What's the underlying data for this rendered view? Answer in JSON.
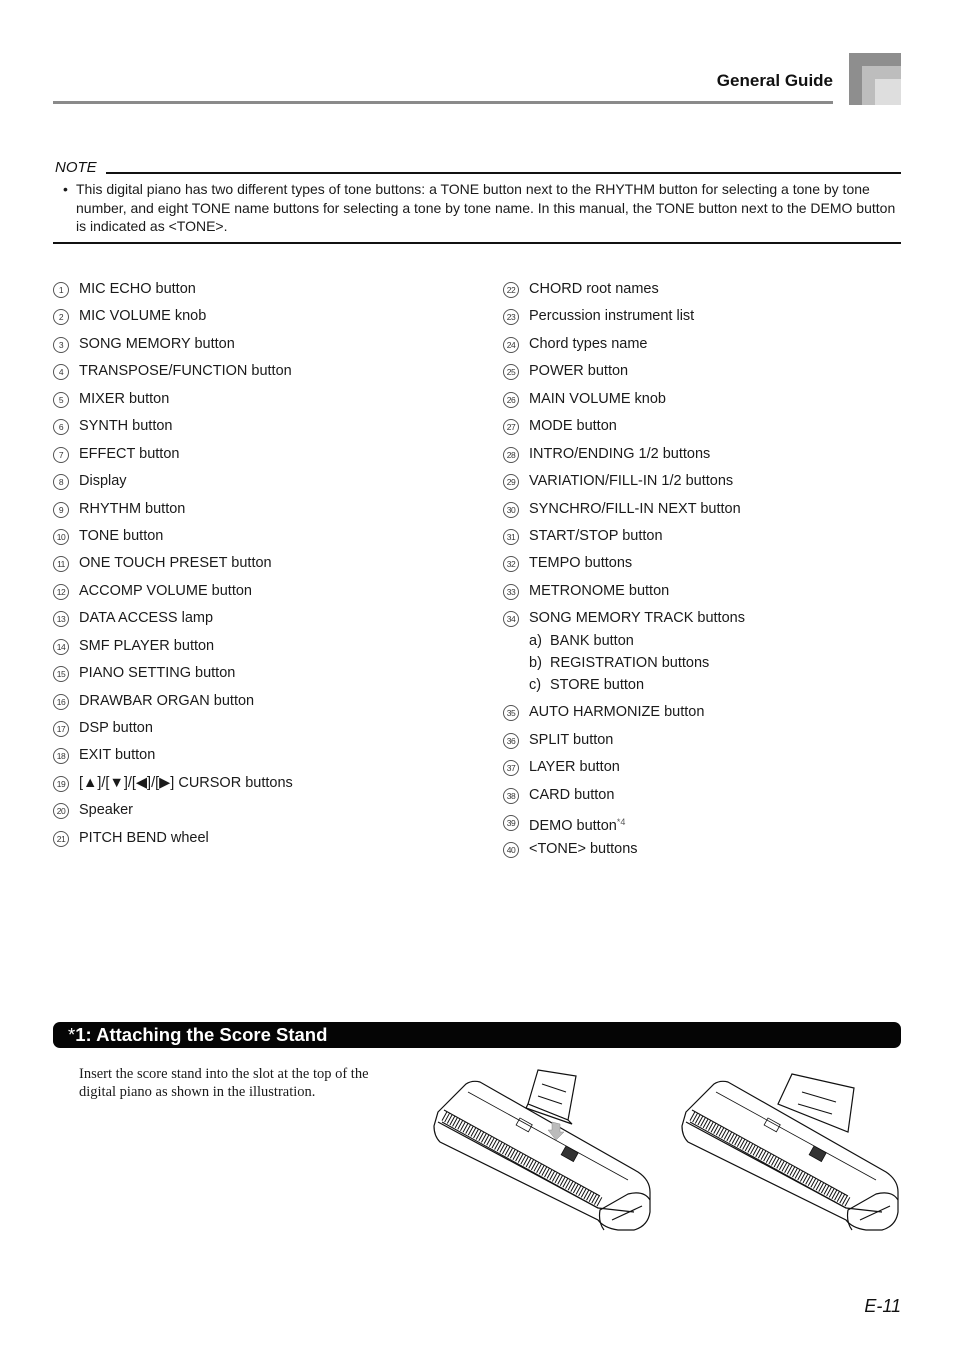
{
  "header": {
    "title": "General Guide"
  },
  "note": {
    "label": "NOTE",
    "bullet": "•",
    "text": "This digital piano has two different types of tone buttons: a TONE button next to the RHYTHM button for selecting a tone by tone number, and eight TONE name buttons for selecting a tone by tone name. In this manual, the TONE button next to the DEMO button is indicated as <TONE>."
  },
  "parts": {
    "left": [
      {
        "num": "1",
        "label": "MIC ECHO button"
      },
      {
        "num": "2",
        "label": "MIC VOLUME knob"
      },
      {
        "num": "3",
        "label": "SONG MEMORY button"
      },
      {
        "num": "4",
        "label": "TRANSPOSE/FUNCTION button"
      },
      {
        "num": "5",
        "label": "MIXER button"
      },
      {
        "num": "6",
        "label": "SYNTH button"
      },
      {
        "num": "7",
        "label": "EFFECT button"
      },
      {
        "num": "8",
        "label": "Display"
      },
      {
        "num": "9",
        "label": "RHYTHM button"
      },
      {
        "num": "10",
        "label": "TONE button"
      },
      {
        "num": "11",
        "label": "ONE TOUCH PRESET button"
      },
      {
        "num": "12",
        "label": "ACCOMP VOLUME button"
      },
      {
        "num": "13",
        "label": "DATA ACCESS lamp"
      },
      {
        "num": "14",
        "label": "SMF PLAYER button"
      },
      {
        "num": "15",
        "label": "PIANO SETTING button"
      },
      {
        "num": "16",
        "label": "DRAWBAR ORGAN button"
      },
      {
        "num": "17",
        "label": "DSP button"
      },
      {
        "num": "18",
        "label": "EXIT button"
      },
      {
        "num": "19",
        "label": "[▲]/[▼]/[◀]/[▶] CURSOR buttons"
      },
      {
        "num": "20",
        "label": "Speaker"
      },
      {
        "num": "21",
        "label": "PITCH BEND wheel"
      }
    ],
    "right": [
      {
        "num": "22",
        "label": "CHORD root names"
      },
      {
        "num": "23",
        "label": "Percussion instrument list"
      },
      {
        "num": "24",
        "label": "Chord types name"
      },
      {
        "num": "25",
        "label": "POWER button"
      },
      {
        "num": "26",
        "label": "MAIN VOLUME knob"
      },
      {
        "num": "27",
        "label": "MODE button"
      },
      {
        "num": "28",
        "label": "INTRO/ENDING 1/2 buttons"
      },
      {
        "num": "29",
        "label": "VARIATION/FILL-IN 1/2 buttons"
      },
      {
        "num": "30",
        "label": "SYNCHRO/FILL-IN NEXT button"
      },
      {
        "num": "31",
        "label": "START/STOP button"
      },
      {
        "num": "32",
        "label": "TEMPO buttons"
      },
      {
        "num": "33",
        "label": "METRONOME button"
      },
      {
        "num": "34",
        "label": "SONG MEMORY TRACK buttons",
        "sub": [
          {
            "letter": "a)",
            "label": "BANK button"
          },
          {
            "letter": "b)",
            "label": "REGISTRATION buttons"
          },
          {
            "letter": "c)",
            "label": "STORE button"
          }
        ]
      },
      {
        "num": "35",
        "label": "AUTO HARMONIZE button"
      },
      {
        "num": "36",
        "label": "SPLIT button"
      },
      {
        "num": "37",
        "label": "LAYER button"
      },
      {
        "num": "38",
        "label": "CARD button"
      },
      {
        "num": "39",
        "label": "DEMO button",
        "sup": "*4"
      },
      {
        "num": "40",
        "label": "<TONE> buttons"
      }
    ]
  },
  "section": {
    "asterisk": "*",
    "title": "1: Attaching the Score Stand",
    "body": "Insert the score stand into the slot at the top of the digital piano as shown in the illustration."
  },
  "illustrations": [
    {
      "name": "piano-score-stand-inserting",
      "description": "Score stand being inserted into slot (arrow)"
    },
    {
      "name": "piano-score-stand-attached",
      "description": "Score stand attached"
    }
  ],
  "footer": {
    "page_number": "E-11"
  }
}
